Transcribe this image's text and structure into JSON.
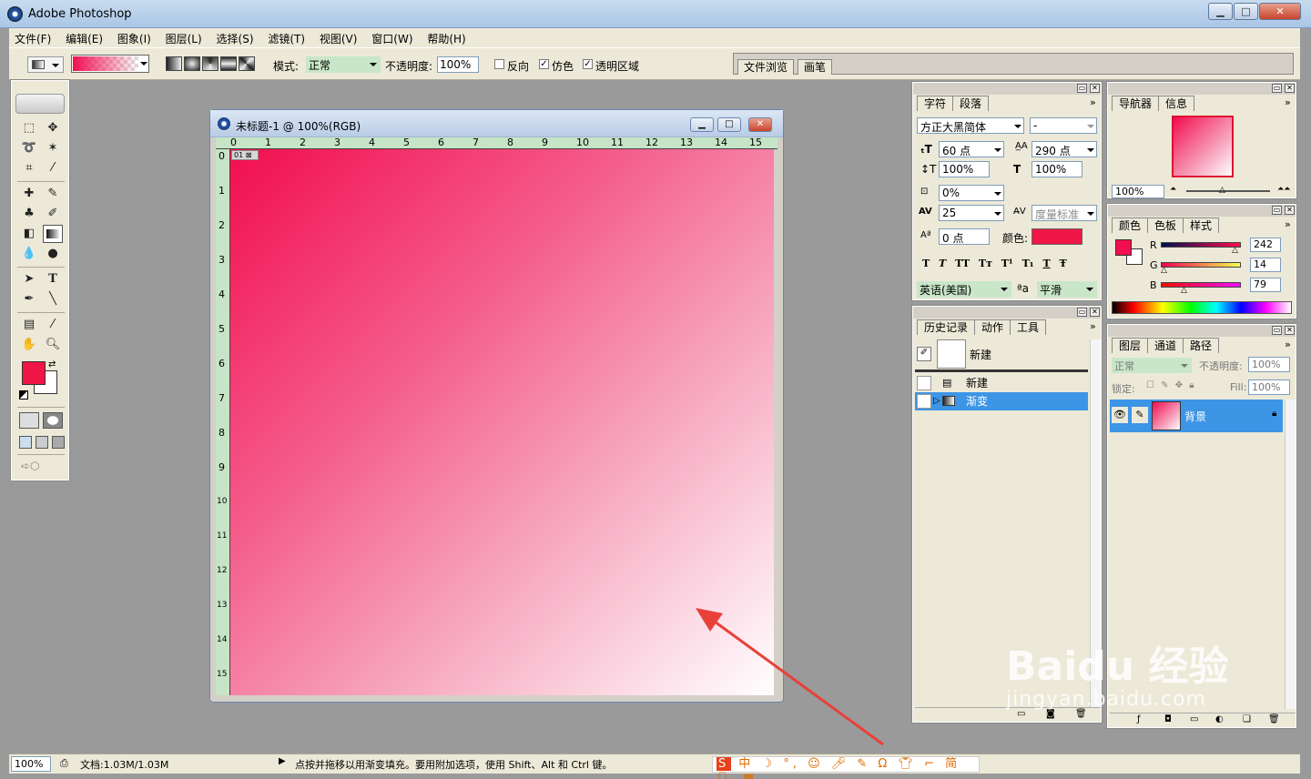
{
  "app": {
    "title": "Adobe Photoshop"
  },
  "window_buttons": {
    "minimize": "▁",
    "maximize": "□",
    "close": "✕"
  },
  "menu": [
    "文件(F)",
    "编辑(E)",
    "图象(I)",
    "图层(L)",
    "选择(S)",
    "滤镜(T)",
    "视图(V)",
    "窗口(W)",
    "帮助(H)"
  ],
  "options": {
    "mode_label": "模式:",
    "mode_value": "正常",
    "opacity_label": "不透明度:",
    "opacity_value": "100%",
    "reverse_label": "反向",
    "dither_label": "仿色",
    "transparency_label": "透明区域",
    "reverse_checked": false,
    "dither_checked": true,
    "transparency_checked": true,
    "gradient_colors": [
      "#f20e4f",
      "#ffffff"
    ]
  },
  "palette_well": {
    "tabs": [
      "文件浏览",
      "画笔"
    ]
  },
  "document": {
    "title": "未标题-1 @ 100%(RGB)",
    "ruler_top": [
      "0",
      "1",
      "2",
      "3",
      "4",
      "5",
      "6",
      "7",
      "8",
      "9",
      "10",
      "11",
      "12",
      "13",
      "14",
      "15"
    ],
    "ruler_left": [
      "0",
      "1",
      "2",
      "3",
      "4",
      "5",
      "6",
      "7",
      "8",
      "9",
      "10",
      "11",
      "12",
      "13",
      "14",
      "15"
    ],
    "slice_badge": "01",
    "gradient_start": "#f20e4f",
    "gradient_end": "#ffffff"
  },
  "character_panel": {
    "tabs": [
      "字符",
      "段落"
    ],
    "font_family": "方正大黑简体",
    "font_style": "-",
    "font_size": "60 点",
    "leading": "290 点",
    "vertical_scale": "100%",
    "horizontal_scale": "100%",
    "tracking_pct": "0%",
    "kerning_label": "度量标准",
    "tracking": "25",
    "baseline": "0 点",
    "color_label": "颜色:",
    "color": "#f01645",
    "style_buttons": [
      "T",
      "T",
      "TT",
      "Tт",
      "T¹",
      "T₁",
      "T",
      "Ŧ"
    ],
    "language": "英语(美国)",
    "aa_label": "ªa",
    "antialias": "平滑"
  },
  "history_panel": {
    "tabs": [
      "历史记录",
      "动作",
      "工具"
    ],
    "snapshot": "新建",
    "items": [
      "新建",
      "渐变"
    ],
    "selected_index": 1
  },
  "navigator_panel": {
    "tabs": [
      "导航器",
      "信息"
    ],
    "zoom": "100%"
  },
  "color_panel": {
    "tabs": [
      "颜色",
      "色板",
      "样式"
    ],
    "channels": [
      {
        "name": "R",
        "value": "242"
      },
      {
        "name": "G",
        "value": "14"
      },
      {
        "name": "B",
        "value": "79"
      }
    ],
    "foreground": "#f20e4f"
  },
  "layers_panel": {
    "tabs": [
      "图层",
      "通道",
      "路径"
    ],
    "blend_mode": "正常",
    "opacity_label": "不透明度:",
    "opacity": "100%",
    "lock_label": "锁定:",
    "fill_label": "Fill:",
    "fill": "100%",
    "layers": [
      {
        "name": "背景",
        "locked": true,
        "visible": true
      }
    ]
  },
  "status": {
    "zoom": "100%",
    "doc_info": "文档:1.03M/1.03M",
    "hint": "点按并拖移以用渐变填充。要用附加选项，使用 Shift、Alt 和 Ctrl 键。"
  },
  "watermark": {
    "brand": "Baidu 经验",
    "url": "jingyan.baidu.com"
  },
  "annotation": {
    "arrow_color": "#e8413a"
  }
}
